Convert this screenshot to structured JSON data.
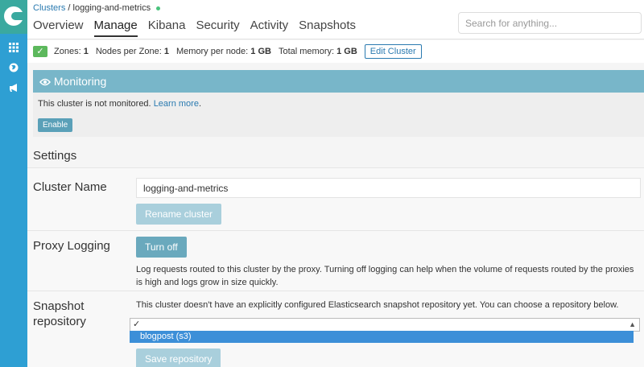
{
  "sidebar": {
    "icons": [
      "grid-icon",
      "globe-icon",
      "megaphone-icon"
    ]
  },
  "breadcrumb": {
    "root": "Clusters",
    "separator": "/",
    "current": "logging-and-metrics"
  },
  "tabs": [
    {
      "label": "Overview"
    },
    {
      "label": "Manage"
    },
    {
      "label": "Kibana"
    },
    {
      "label": "Security"
    },
    {
      "label": "Activity"
    },
    {
      "label": "Snapshots"
    }
  ],
  "search": {
    "placeholder": "Search for anything..."
  },
  "info_bar": {
    "zones_label": "Zones:",
    "zones_value": "1",
    "nodes_label": "Nodes per Zone:",
    "nodes_value": "1",
    "memory_label": "Memory per node:",
    "memory_value": "1 GB",
    "total_label": "Total memory:",
    "total_value": "1 GB",
    "edit_button": "Edit Cluster"
  },
  "monitoring": {
    "title": "Monitoring",
    "text": "This cluster is not monitored.",
    "link": "Learn more",
    "after_link": ".",
    "enable_button": "Enable"
  },
  "settings": {
    "title": "Settings",
    "cluster_name": {
      "label": "Cluster Name",
      "value": "logging-and-metrics",
      "button": "Rename cluster"
    },
    "proxy_logging": {
      "label": "Proxy Logging",
      "button": "Turn off",
      "description": "Log requests routed to this cluster by the proxy. Turning off logging can help when the volume of requests routed by the proxies is high and logs grow in size quickly."
    },
    "snapshot": {
      "label_line1": "Snapshot",
      "label_line2": "repository",
      "description": "This cluster doesn't have an explicitly configured Elasticsearch snapshot repository yet. You can choose a repository below.",
      "selected": "✓",
      "option": "blogpost (s3)",
      "save_button": "Save repository"
    }
  },
  "colors": {
    "sidebar": "#2e9fd3",
    "logo_bg": "#3aa99f",
    "monitor_header": "#78b6c9",
    "primary_button": "#6aa9bd",
    "status_dot": "#4ac37d",
    "selected_option": "#3c8fd8"
  }
}
